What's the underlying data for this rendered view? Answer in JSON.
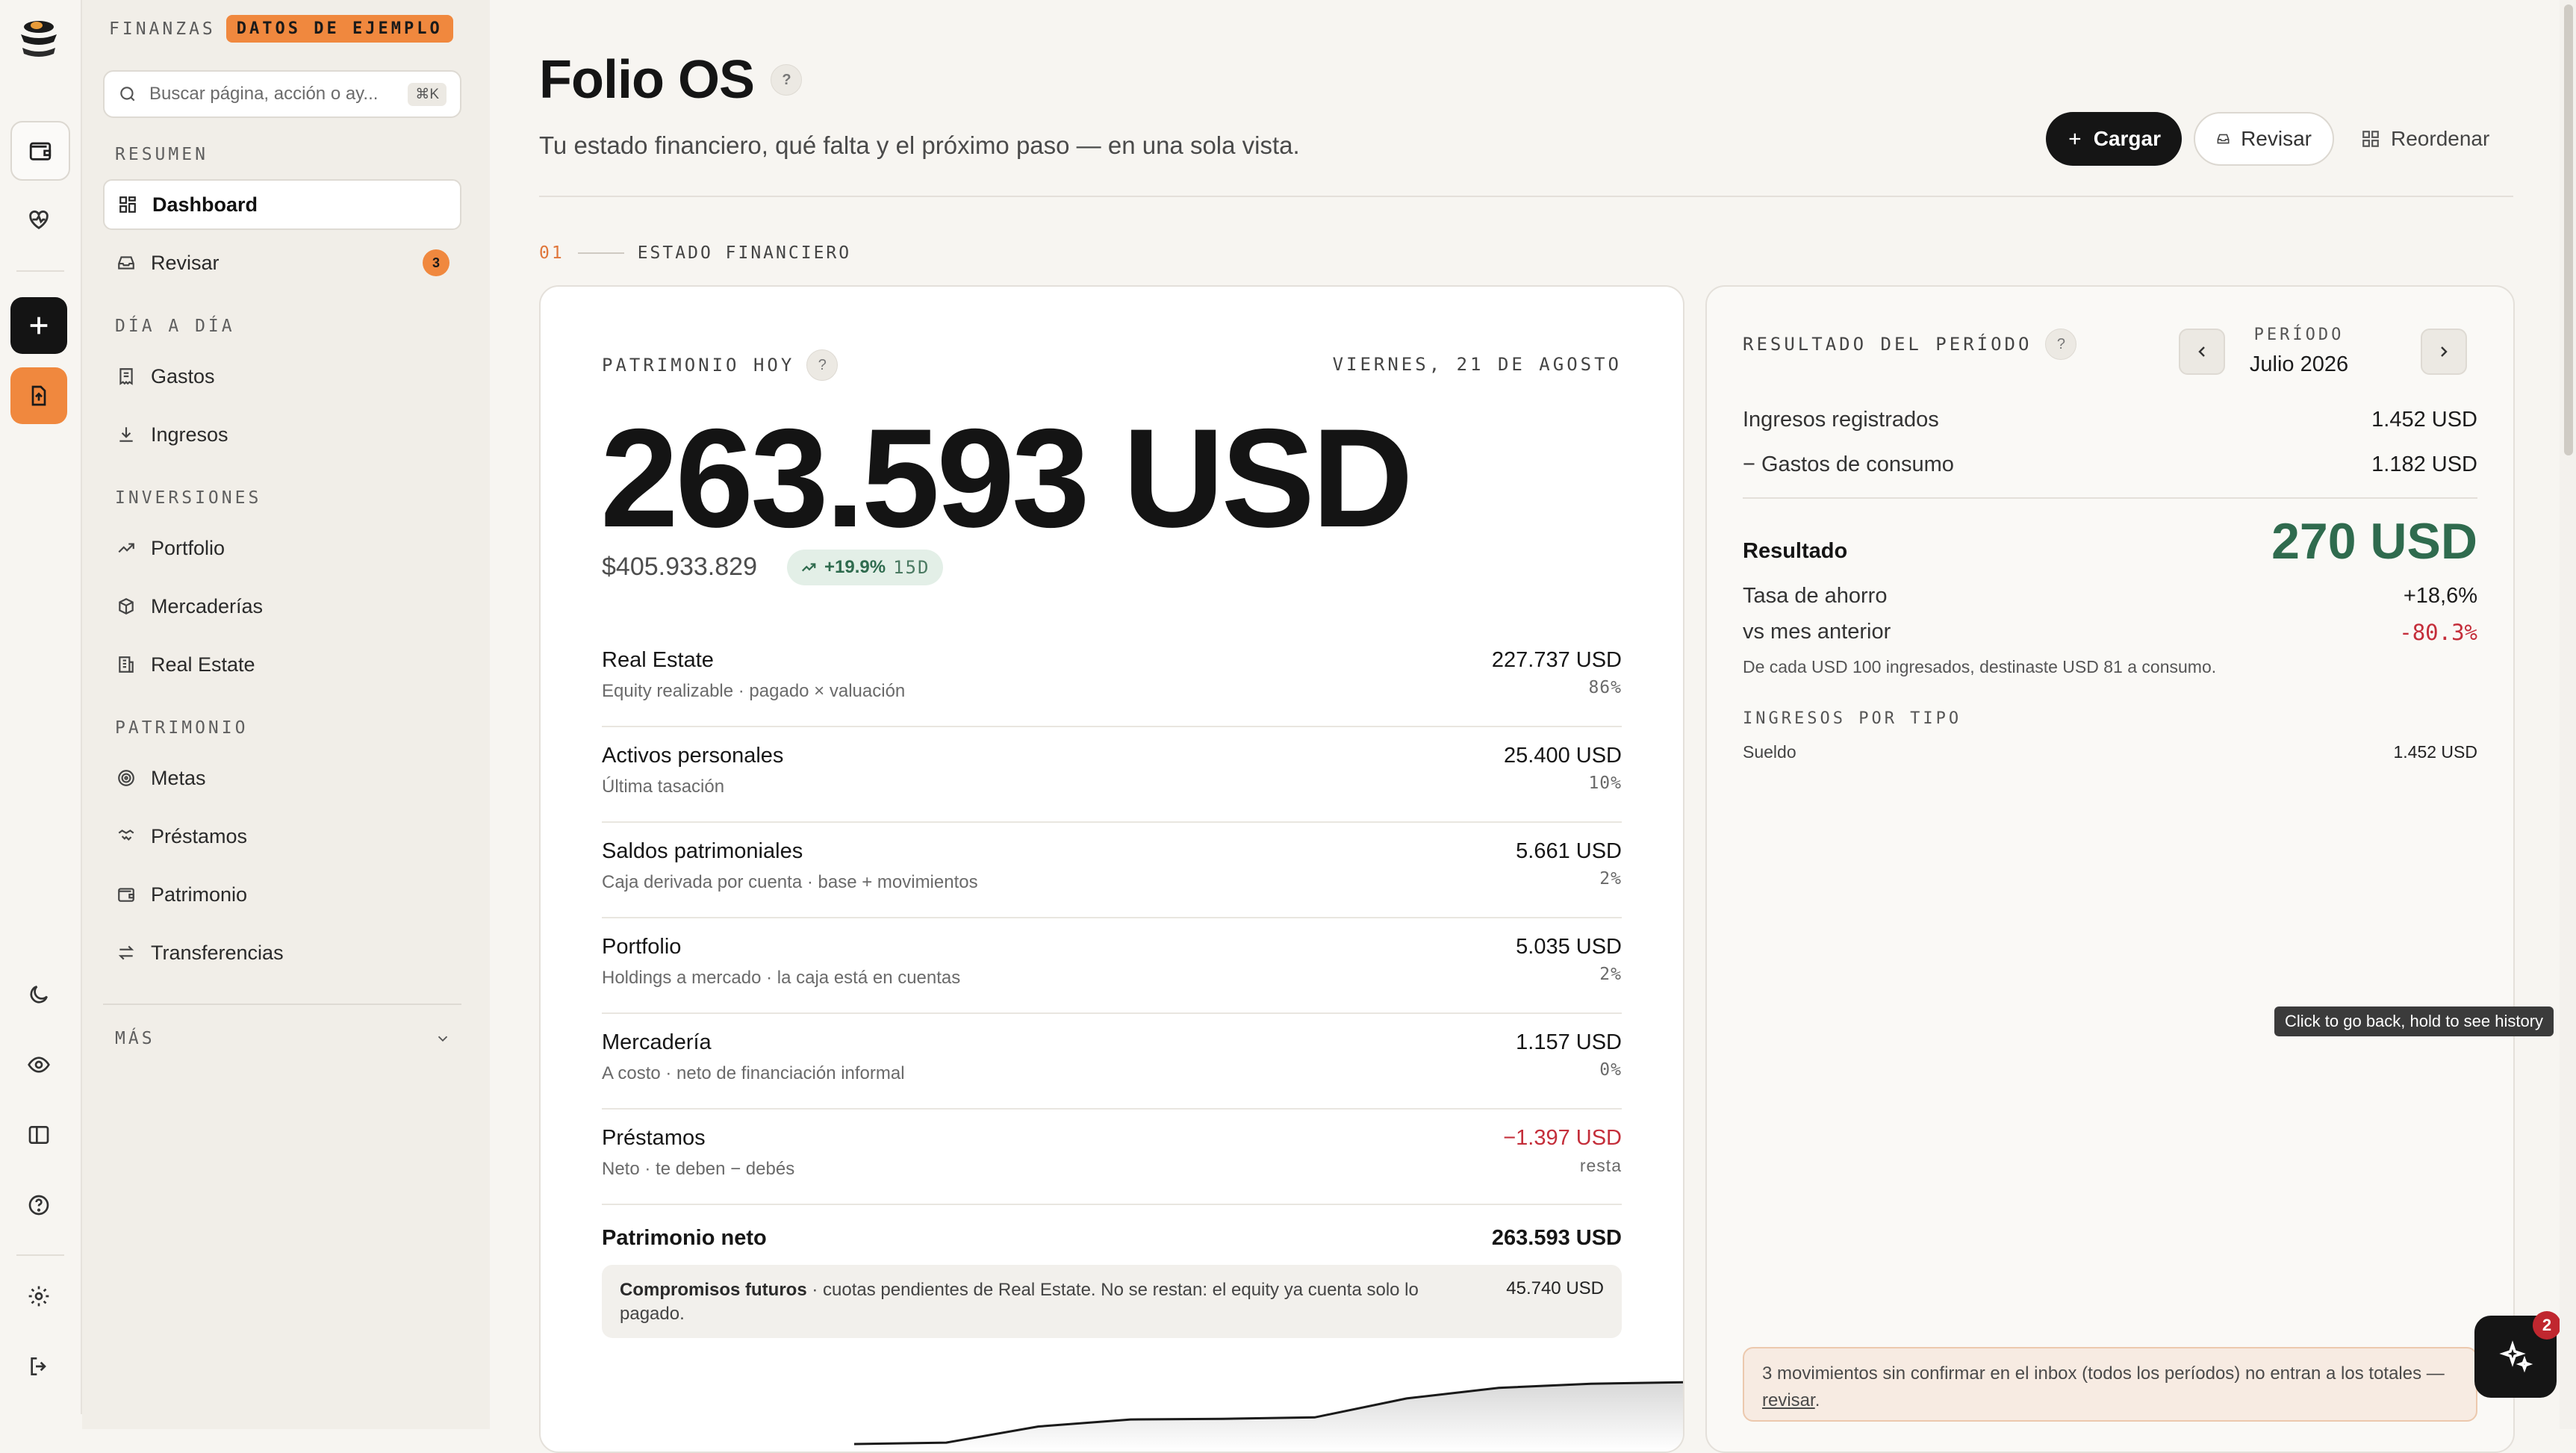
{
  "sidebar": {
    "brand": "FINANZAS",
    "badge": "DATOS DE EJEMPLO",
    "search_placeholder": "Buscar página, acción o ay...",
    "search_kbd": "⌘K",
    "sections": {
      "resumen": "RESUMEN",
      "dia": "DÍA A DÍA",
      "inversiones": "INVERSIONES",
      "patrimonio": "PATRIMONIO",
      "mas": "MÁS"
    },
    "items": {
      "dashboard": "Dashboard",
      "revisar": "Revisar",
      "revisar_count": "3",
      "gastos": "Gastos",
      "ingresos": "Ingresos",
      "portfolio": "Portfolio",
      "mercaderias": "Mercaderías",
      "real_estate": "Real Estate",
      "metas": "Metas",
      "prestamos": "Préstamos",
      "patrimonio": "Patrimonio",
      "transferencias": "Transferencias"
    }
  },
  "header": {
    "title": "Folio OS",
    "help": "?",
    "subtitle": "Tu estado financiero, qué falta y el próximo paso — en una sola vista.",
    "btn_cargar": "Cargar",
    "btn_revisar": "Revisar",
    "btn_reordenar": "Reordenar"
  },
  "section": {
    "num": "01",
    "label": "ESTADO FINANCIERO"
  },
  "patrimonio": {
    "label": "PATRIMONIO HOY",
    "help": "?",
    "date": "VIERNES, 21 DE AGOSTO",
    "total": "263.593 USD",
    "ars": "$405.933.829",
    "change": "+19.9%",
    "change_period": "15D",
    "rows": [
      {
        "name": "Real Estate",
        "desc": "Equity realizable · pagado × valuación",
        "value": "227.737 USD",
        "pct": "86%"
      },
      {
        "name": "Activos personales",
        "desc": "Última tasación",
        "value": "25.400 USD",
        "pct": "10%"
      },
      {
        "name": "Saldos patrimoniales",
        "desc": "Caja derivada por cuenta · base + movimientos",
        "value": "5.661 USD",
        "pct": "2%"
      },
      {
        "name": "Portfolio",
        "desc": "Holdings a mercado · la caja está en cuentas",
        "value": "5.035 USD",
        "pct": "2%"
      },
      {
        "name": "Mercadería",
        "desc": "A costo · neto de financiación informal",
        "value": "1.157 USD",
        "pct": "0%"
      },
      {
        "name": "Préstamos",
        "desc": "Neto · te deben − debés",
        "value": "−1.397 USD",
        "pct": "resta"
      }
    ],
    "neto_label": "Patrimonio neto",
    "neto_value": "263.593 USD",
    "commit_bold": "Compromisos futuros",
    "commit_text": " · cuotas pendientes de Real Estate. No se restan: el equity ya cuenta solo lo pagado.",
    "commit_value": "45.740 USD",
    "trend": [
      0.0,
      0.02,
      0.25,
      0.35,
      0.36,
      0.38,
      0.65,
      0.8,
      0.86,
      0.88
    ]
  },
  "resultado": {
    "label": "RESULTADO DEL PERÍODO",
    "help": "?",
    "period_label": "PERÍODO",
    "period_value": "Julio 2026",
    "ingresos_label": "Ingresos registrados",
    "ingresos_value": "1.452 USD",
    "gastos_label": "− Gastos de consumo",
    "gastos_value": "1.182 USD",
    "resultado_label": "Resultado",
    "resultado_value": "270 USD",
    "tasa_label": "Tasa de ahorro",
    "tasa_value": "+18,6%",
    "vs_label": "vs mes anterior",
    "vs_value": "-80.3%",
    "note": "De cada USD 100 ingresados, destinaste USD 81 a consumo.",
    "ingresos_tipo_label": "INGRESOS POR TIPO",
    "tipo_sueldo_label": "Sueldo",
    "tipo_sueldo_value": "1.452 USD",
    "alert_text": "3 movimientos sin confirmar en el inbox (todos los períodos) no entran a los totales — ",
    "alert_link": "revisar",
    "alert_end": "."
  },
  "tooltip": "Click to go back, hold to see history",
  "fab_badge": "2",
  "colors": {
    "accent": "#f0883e",
    "positive": "#2f6b4e",
    "negative": "#c42e3a"
  }
}
